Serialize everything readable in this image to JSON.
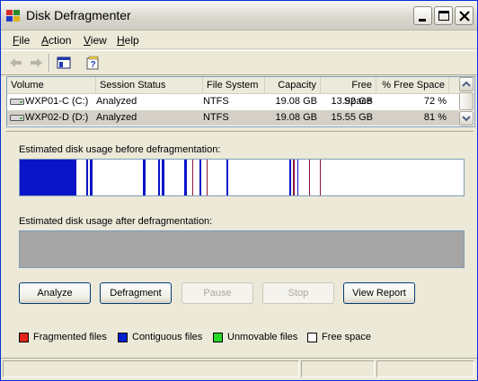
{
  "window": {
    "title": "Disk Defragmenter"
  },
  "menu": [
    {
      "label": "File",
      "accel": "F",
      "rest": "ile"
    },
    {
      "label": "Action",
      "accel": "A",
      "rest": "ction"
    },
    {
      "label": "View",
      "accel": "V",
      "rest": "iew"
    },
    {
      "label": "Help",
      "accel": "H",
      "rest": "elp"
    }
  ],
  "columns": [
    "Volume",
    "Session Status",
    "File System",
    "Capacity",
    "Free Space",
    "% Free Space"
  ],
  "rows": [
    {
      "volume": "WXP01-C (C:)",
      "status": "Analyzed",
      "fs": "NTFS",
      "capacity": "19.08 GB",
      "free": "13.92 GB",
      "pct": "72 %"
    },
    {
      "volume": "WXP02-D (D:)",
      "status": "Analyzed",
      "fs": "NTFS",
      "capacity": "19.08 GB",
      "free": "15.55 GB",
      "pct": "81 %"
    }
  ],
  "labels": {
    "before": "Estimated disk usage before defragmentation:",
    "after": "Estimated disk usage after defragmentation:"
  },
  "buttons": {
    "analyze": "Analyze",
    "defragment": "Defragment",
    "pause": "Pause",
    "stop": "Stop",
    "view_report": "View Report"
  },
  "legend": [
    {
      "label": "Fragmented files",
      "color": "#e2231a"
    },
    {
      "label": "Contiguous files",
      "color": "#0020d0"
    },
    {
      "label": "Unmovable files",
      "color": "#28d828"
    },
    {
      "label": "Free space",
      "color": "#ffffff"
    }
  ],
  "colors": {
    "fragmented": "#8b1a3a",
    "contiguous": "#0a14c8",
    "after_bar": "#a5a5a5"
  }
}
